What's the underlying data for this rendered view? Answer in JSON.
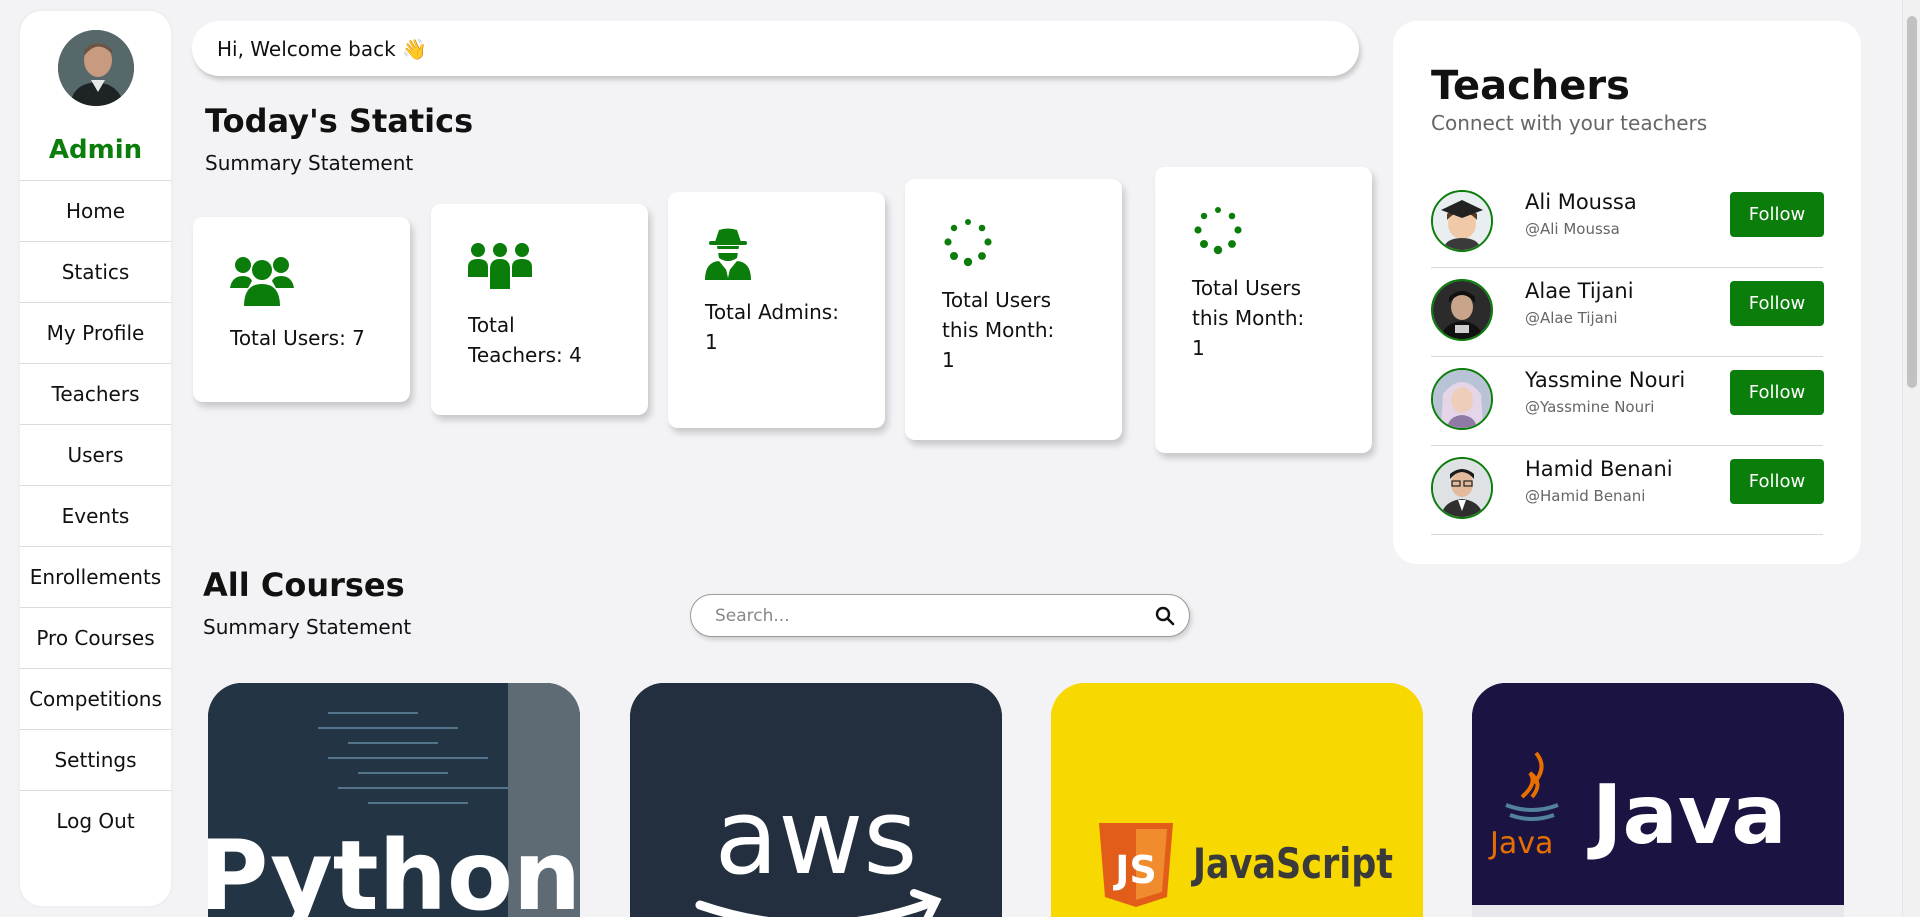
{
  "sidebar": {
    "user_label": "Admin",
    "items": [
      {
        "label": "Home"
      },
      {
        "label": "Statics"
      },
      {
        "label": "My Profile"
      },
      {
        "label": "Teachers"
      },
      {
        "label": "Users"
      },
      {
        "label": "Events"
      },
      {
        "label": "Enrollements"
      },
      {
        "label": "Pro Courses"
      },
      {
        "label": "Competitions"
      },
      {
        "label": "Settings"
      },
      {
        "label": "Log Out"
      }
    ]
  },
  "header": {
    "welcome": "Hi, Welcome back 👋"
  },
  "stats": {
    "title": "Today's Statics",
    "subtitle": "Summary Statement",
    "cards": [
      {
        "label": "Total Users: 7",
        "icon": "users-icon"
      },
      {
        "label": "Total Teachers: 4",
        "icon": "teachers-group-icon"
      },
      {
        "label": "Total Admins: 1",
        "icon": "user-secret-icon"
      },
      {
        "label": "Total Users this Month: 1",
        "icon": "spinner-icon"
      },
      {
        "label": "Total Users this Month: 1",
        "icon": "spinner-icon"
      }
    ]
  },
  "teachers": {
    "title": "Teachers",
    "subtitle": "Connect with your teachers",
    "follow_label": "Follow",
    "list": [
      {
        "name": "Ali Moussa",
        "handle": "@Ali Moussa"
      },
      {
        "name": "Alae Tijani",
        "handle": "@Alae Tijani"
      },
      {
        "name": "Yassmine Nouri",
        "handle": "@Yassmine Nouri"
      },
      {
        "name": "Hamid Benani",
        "handle": "@Hamid Benani"
      }
    ]
  },
  "courses": {
    "title": "All Courses",
    "subtitle": "Summary Statement",
    "search_placeholder": "Search...",
    "items": [
      {
        "image_text": "Python"
      },
      {
        "image_text": "aws"
      },
      {
        "image_text": "JavaScript"
      },
      {
        "image_text": "Java",
        "image_subtext": "Java"
      }
    ]
  },
  "colors": {
    "accent": "#0a7d0a",
    "background": "#f3f3f6"
  }
}
